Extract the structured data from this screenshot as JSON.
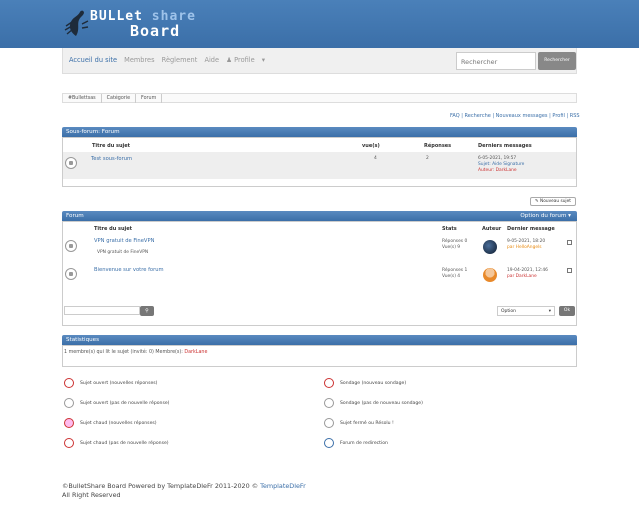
{
  "brand": {
    "line1_a": "BULLet",
    "line1_b": "share",
    "line2": "Board"
  },
  "nav": {
    "items": [
      "Accueil du site",
      "Membres",
      "Règlement",
      "Aide"
    ],
    "profile": "Profile",
    "search_placeholder": "Rechercher",
    "search_button": "Rechercher"
  },
  "breadcrumb": [
    "#Bullettsas",
    "Catégorie",
    "Forum"
  ],
  "top_links": "FAQ | Recherche | Nouveaux messages | Profil | RSS",
  "subforum": {
    "title": "Sous-forum: Forum",
    "headers": {
      "topic": "Titre du sujet",
      "views": "vue(s)",
      "replies": "Réponses",
      "last": "Derniers messages"
    },
    "row": {
      "title": "Test sous-forum",
      "views": "4",
      "replies": "2",
      "last_date": "6-05-2021, 19:57",
      "last_subject": "Sujet: Aide Signature",
      "last_author": "Auteur: DarkLane"
    }
  },
  "new_topic_button": "Nouveau sujet",
  "forum": {
    "title": "Forum",
    "options": "Option du forum",
    "headers": {
      "topic": "Titre du sujet",
      "stats": "Stats",
      "author": "Auteur",
      "last": "Dernier message"
    },
    "rows": [
      {
        "title": "VPN gratuit de FineVPN",
        "sub": "VPN gratuit de FineVPN",
        "replies": "Réponses 0",
        "views": "Vue(s) 9",
        "last_date": "9-05-2021, 18:20",
        "last_by": "par HelloAngels"
      },
      {
        "title": "Bienvenue sur votre forum",
        "sub": "",
        "replies": "Réponses 1",
        "views": "Vue(s) 4",
        "last_date": "19-04-2021, 12:46",
        "last_by": "par DarkLane"
      }
    ],
    "option_select": "Option",
    "ok_button": "Ok"
  },
  "stats": {
    "title": "Statistiques",
    "text": "1 membre(s) qui lit le sujet (invité: 0) Membre(s): ",
    "member": "DarkLane"
  },
  "legend": [
    "Sujet ouvert (nouvelles réponses)",
    "Sujet ouvert (pas de nouvelle réponse)",
    "Sujet chaud (nouvelles réponses)",
    "Sujet chaud (pas de nouvelle réponse)",
    "Sondage (nouveau sondage)",
    "Sondage (pas de nouveau sondage)",
    "Sujet fermé ou Résolu !",
    "Forum de redirection"
  ],
  "footer": {
    "text": "©BulletShare Board Powered by TemplateDleFr 2011-2020 © ",
    "link": "TemplateDleFr",
    "rights": "All Right Reserved"
  },
  "colors": {
    "header": "#3b6fa8",
    "link": "#3b6fa8",
    "accent_red": "#c33"
  }
}
